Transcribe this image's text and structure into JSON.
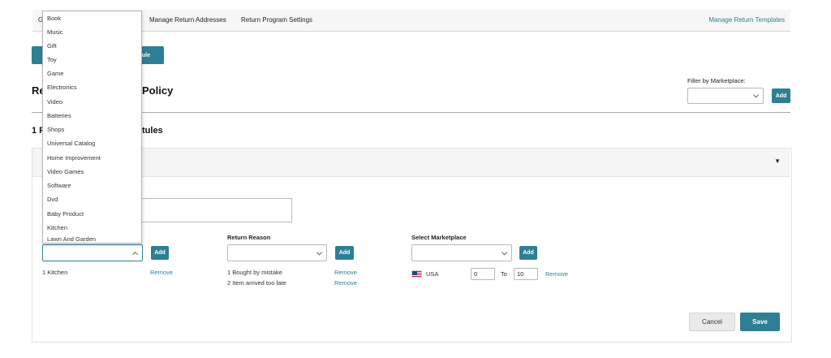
{
  "nav": {
    "first_item_partial": "G",
    "items": [
      "Manage Return Addresses",
      "Return Program Settings"
    ],
    "right_link": "Manage Return Templates"
  },
  "create_rule_button_partial": "ule",
  "page_heading_partial_left": "Re",
  "page_heading_partial_right": "Policy",
  "filter": {
    "label": "Filter by Marketplace:",
    "selected": "",
    "add_label": "Add"
  },
  "rules_heading_partial_left": "1 F",
  "rules_heading_partial_right": "tules",
  "editor": {
    "category_select_value": "",
    "category_add_label": "Add",
    "categories_added": [
      {
        "text": "1 Kitchen",
        "remove": "Remove"
      }
    ],
    "return_reason": {
      "label": "Return Reason",
      "selected": "",
      "add_label": "Add",
      "items": [
        {
          "text": "1 Bought by mistake",
          "remove": "Remove"
        },
        {
          "text": "2 Item arrived too late",
          "remove": "Remove"
        }
      ]
    },
    "marketplace": {
      "label": "Select Marketplace",
      "selected": "",
      "add_label": "Add",
      "row": {
        "country": "USA",
        "from_value": "0",
        "to_label": "To",
        "to_value": "10",
        "remove": "Remove"
      }
    },
    "cancel_label": "Cancel",
    "save_label": "Save"
  },
  "category_dropdown": {
    "options": [
      "Book",
      "Music",
      "Gift",
      "Toy",
      "Game",
      "Electronics",
      "Video",
      "Batteries",
      "Shops",
      "Universal Catalog",
      "Home Improvement",
      "Video Games",
      "Software",
      "Dvd",
      "Baby Product",
      "Kitchen",
      "Lawn And Garden"
    ]
  },
  "colors": {
    "accent": "#2e7f93",
    "link": "#2e7f93",
    "panel_header_bg": "#f5f5f5"
  },
  "icons": {
    "panel_toggle": "caret-down-icon",
    "select_chevron": "chevron-down-icon",
    "open_select_chevron": "chevron-up-icon",
    "flag": "us-flag-icon"
  }
}
